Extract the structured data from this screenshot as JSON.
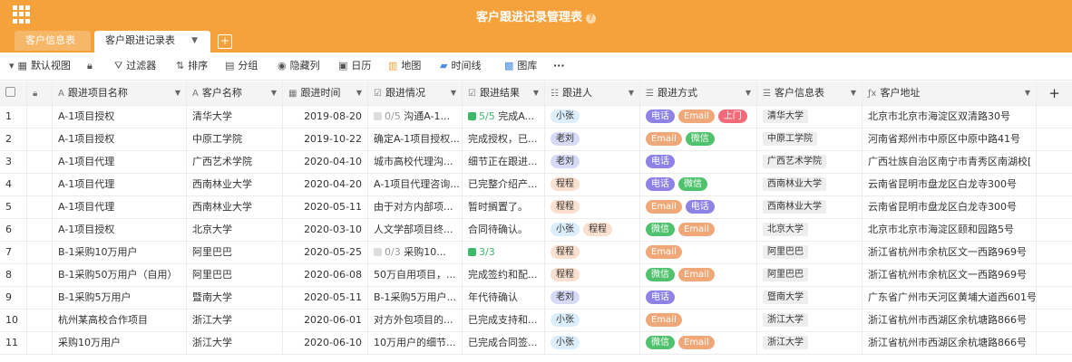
{
  "header": {
    "title": "客户跟进记录管理表",
    "info_glyph": "?"
  },
  "tabs": [
    {
      "label": "客户信息表"
    },
    {
      "label": "客户跟进记录表"
    }
  ],
  "toolbar": {
    "view": "默认视图",
    "filter": "过滤器",
    "sort": "排序",
    "group": "分组",
    "hide": "隐藏列",
    "calendar": "日历",
    "map": "地图",
    "timeline": "时间线",
    "gallery": "图库",
    "more": "···"
  },
  "columns": {
    "name": "跟进项目名称",
    "customer": "客户名称",
    "date": "跟进时间",
    "situation": "跟进情况",
    "result": "跟进结果",
    "person": "跟进人",
    "way": "跟进方式",
    "info": "客户信息表",
    "address": "客户地址"
  },
  "rows": [
    {
      "no": "1",
      "name": "A-1项目授权",
      "customer": "清华大学",
      "date": "2019-08-20",
      "sit_count": "0/5",
      "situation": "沟通A-1...",
      "res_count": "5/5",
      "result": "完成A...",
      "persons": [
        "小张"
      ],
      "ways": [
        "电话",
        "Email",
        "上门"
      ],
      "info": "清华大学",
      "address": "北京市北京市海淀区双清路30号"
    },
    {
      "no": "2",
      "name": "A-1项目授权",
      "customer": "中原工学院",
      "date": "2019-10-22",
      "situation": "确定A-1项目授权...",
      "result": "完成授权，已...",
      "persons": [
        "老刘"
      ],
      "ways": [
        "Email",
        "微信"
      ],
      "info": "中原工学院",
      "address": "河南省郑州市中原区中原中路41号"
    },
    {
      "no": "3",
      "name": "A-1项目代理",
      "customer": "广西艺术学院",
      "date": "2020-04-10",
      "situation": "城市高校代理沟...",
      "result": "细节正在跟进...",
      "persons": [
        "老刘"
      ],
      "ways": [
        "电话"
      ],
      "info": "广西艺术学院",
      "address": "广西壮族自治区南宁市青秀区南湖校["
    },
    {
      "no": "4",
      "name": "A-1项目代理",
      "customer": "西南林业大学",
      "date": "2020-04-20",
      "situation": "A-1项目代理咨询...",
      "result": "已完整介绍产...",
      "persons": [
        "程程"
      ],
      "ways": [
        "电话",
        "微信"
      ],
      "info": "西南林业大学",
      "address": "云南省昆明市盘龙区白龙寺300号"
    },
    {
      "no": "5",
      "name": "A-1项目代理",
      "customer": "西南林业大学",
      "date": "2020-05-11",
      "situation": "由于对方内部项...",
      "result": "暂时搁置了。",
      "persons": [
        "程程"
      ],
      "ways": [
        "Email",
        "电话"
      ],
      "info": "西南林业大学",
      "address": "云南省昆明市盘龙区白龙寺300号"
    },
    {
      "no": "6",
      "name": "A-1项目授权",
      "customer": "北京大学",
      "date": "2020-03-10",
      "situation": "人文学部项目终...",
      "result": "合同待确认。",
      "persons": [
        "小张",
        "程程"
      ],
      "ways": [
        "微信",
        "Email"
      ],
      "info": "北京大学",
      "address": "北京市北京市海淀区颐和园路5号"
    },
    {
      "no": "7",
      "name": "B-1采购10万用户",
      "customer": "阿里巴巴",
      "date": "2020-05-25",
      "sit_count": "0/3",
      "situation": "采购10...",
      "res_count": "3/3",
      "result": "",
      "persons": [
        "程程"
      ],
      "ways": [
        "Email"
      ],
      "info": "阿里巴巴",
      "address": "浙江省杭州市余杭区文一西路969号"
    },
    {
      "no": "8",
      "name": "B-1采购50万用户（自用）",
      "customer": "阿里巴巴",
      "date": "2020-06-08",
      "situation": "50万自用项目，...",
      "result": "完成签约和配...",
      "persons": [
        "程程"
      ],
      "ways": [
        "微信",
        "Email"
      ],
      "info": "阿里巴巴",
      "address": "浙江省杭州市余杭区文一西路969号"
    },
    {
      "no": "9",
      "name": "B-1采购5万用户",
      "customer": "暨南大学",
      "date": "2020-05-11",
      "situation": "B-1采购5万用户...",
      "result": "年代待确认",
      "persons": [
        "老刘"
      ],
      "ways": [
        "电话"
      ],
      "info": "暨南大学",
      "address": "广东省广州市天河区黄埔大道西601号"
    },
    {
      "no": "10",
      "name": "杭州某高校合作项目",
      "customer": "浙江大学",
      "date": "2020-06-01",
      "situation": "对方外包项目的...",
      "result": "已完成支持和...",
      "persons": [
        "小张"
      ],
      "ways": [
        "Email"
      ],
      "info": "浙江大学",
      "address": "浙江省杭州市西湖区余杭塘路866号"
    },
    {
      "no": "11",
      "name": "采购10万用户",
      "customer": "浙江大学",
      "date": "2020-06-10",
      "situation": "10万用户的细节...",
      "result": "已完成合同签...",
      "persons": [
        "小张"
      ],
      "ways": [
        "微信",
        "Email"
      ],
      "info": "浙江大学",
      "address": "浙江省杭州市西湖区余杭塘路866号"
    }
  ],
  "colors": {
    "header": "#f5a13c",
    "phone_tag": "#8e82e6",
    "email_tag": "#f0a878",
    "wechat_tag": "#50c16c",
    "visit_tag": "#f06a7a"
  }
}
